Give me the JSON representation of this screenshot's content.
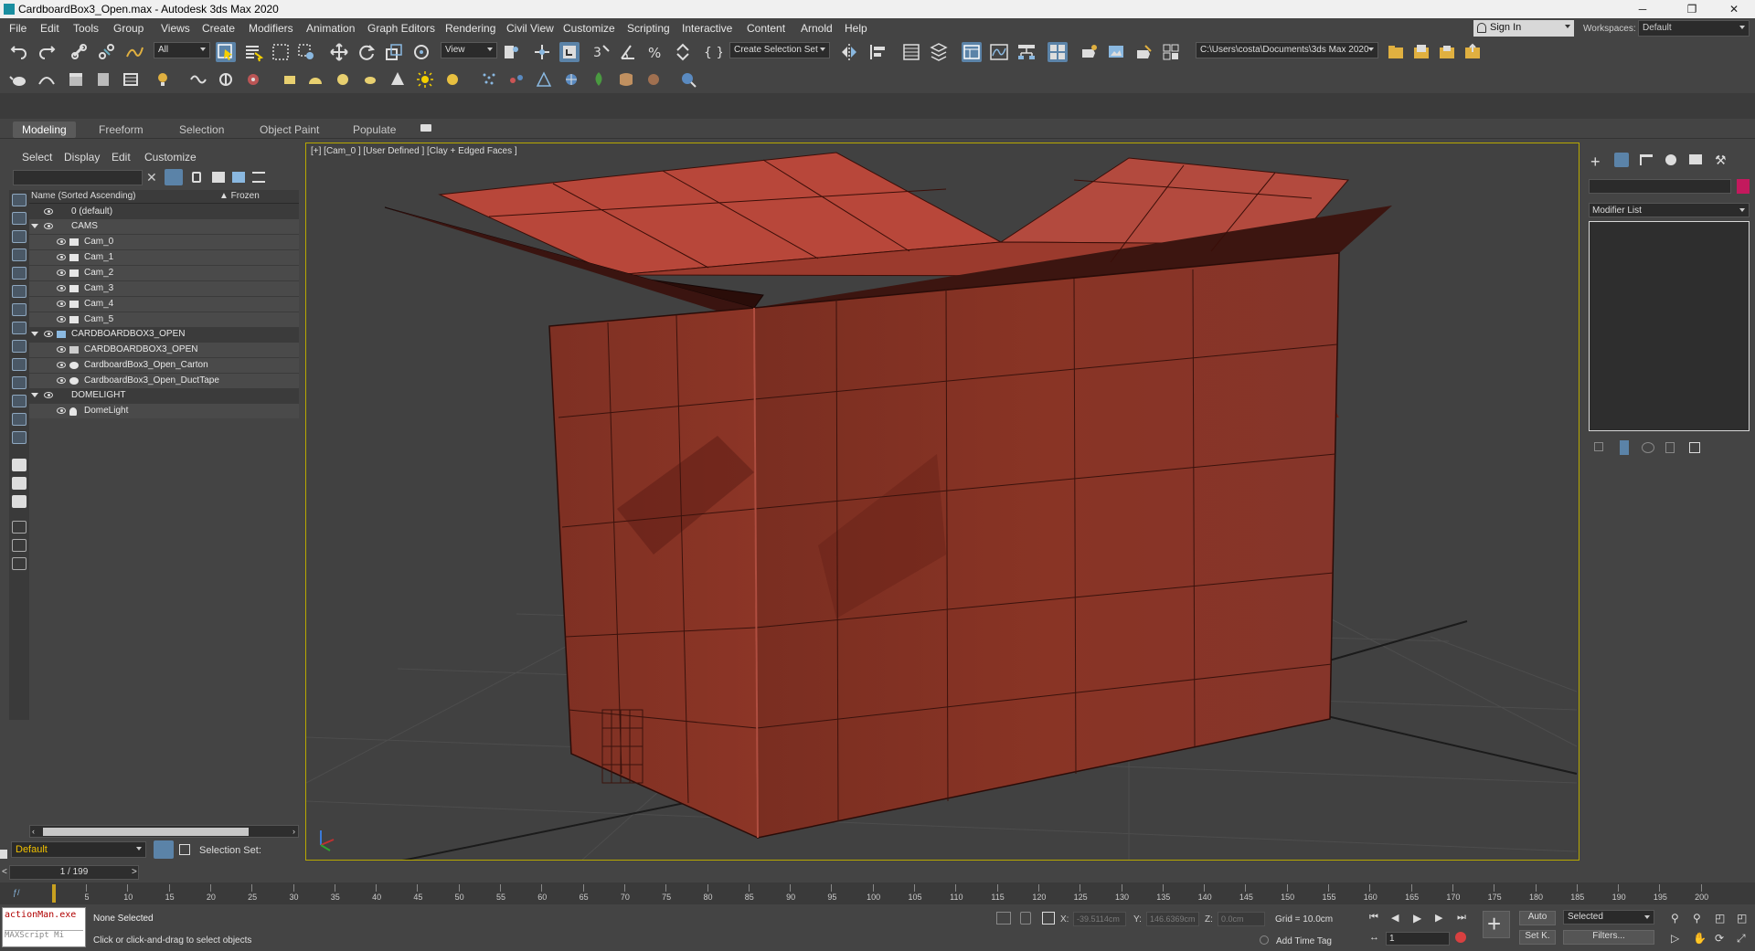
{
  "window": {
    "title": "CardboardBox3_Open.max - Autodesk 3ds Max 2020",
    "minimize": "─",
    "restore": "❐",
    "close": "✕"
  },
  "menu": [
    "File",
    "Edit",
    "Tools",
    "Group",
    "Views",
    "Create",
    "Modifiers",
    "Animation",
    "Graph Editors",
    "Rendering",
    "Civil View",
    "Customize",
    "Scripting",
    "Interactive",
    "Content",
    "Arnold",
    "Help"
  ],
  "signin": "Sign In",
  "workspaces": {
    "label": "Workspaces:",
    "value": "Default"
  },
  "toolbar": {
    "filter_dd": "All",
    "refcoord_dd": "View",
    "selection_set_dd": "Create Selection Set",
    "project_path": "C:\\Users\\costa\\Documents\\3ds Max 2020"
  },
  "ribbon_tabs": [
    "Modeling",
    "Freeform",
    "Selection",
    "Object Paint",
    "Populate"
  ],
  "scene_explorer": {
    "menu": [
      "Select",
      "Display",
      "Edit",
      "Customize"
    ],
    "col_name": "Name (Sorted Ascending)",
    "col_frozen": "▲ Frozen",
    "rows": [
      {
        "label": "0 (default)"
      },
      {
        "label": "CAMS"
      },
      {
        "label": "Cam_0"
      },
      {
        "label": "Cam_1"
      },
      {
        "label": "Cam_2"
      },
      {
        "label": "Cam_3"
      },
      {
        "label": "Cam_4"
      },
      {
        "label": "Cam_5"
      },
      {
        "label": "CARDBOARDBOX3_OPEN"
      },
      {
        "label": "CARDBOARDBOX3_OPEN"
      },
      {
        "label": "CardboardBox3_Open_Carton"
      },
      {
        "label": "CardboardBox3_Open_DuctTape"
      },
      {
        "label": "DOMELIGHT"
      },
      {
        "label": "DomeLight"
      }
    ],
    "layer": "Default",
    "selection_set_label": "Selection Set:"
  },
  "viewport": {
    "label": "[+] [Cam_0 ] [User Defined ] [Clay + Edged Faces ]"
  },
  "command_panel": {
    "modifier_list": "Modifier List"
  },
  "timeline": {
    "frame": "1 / 199",
    "ticks": [
      "5",
      "10",
      "15",
      "20",
      "25",
      "30",
      "35",
      "40",
      "45",
      "50",
      "55",
      "60",
      "65",
      "70",
      "75",
      "80",
      "85",
      "90",
      "95",
      "100",
      "105",
      "110",
      "115",
      "120",
      "125",
      "130",
      "135",
      "140",
      "145",
      "150",
      "155",
      "160",
      "165",
      "170",
      "175",
      "180",
      "185",
      "190",
      "195",
      "200"
    ]
  },
  "status": {
    "maxscript_line1": "actionMan.exe",
    "maxscript_line2": "MAXScript Mi",
    "selection": "None Selected",
    "prompt": "Click or click-and-drag to select objects",
    "x_label": "X:",
    "x_value": "-39.5114cm",
    "y_label": "Y:",
    "y_value": "146.6369cm",
    "z_label": "Z:",
    "z_value": "0.0cm",
    "grid": "Grid = 10.0cm",
    "add_time_tag": "Add Time Tag",
    "auto": "Auto",
    "set_key": "Set K.",
    "selected_dd": "Selected",
    "filters": "Filters...",
    "frame_field": "1"
  },
  "colors": {
    "box": "#8a3527",
    "box_flap": "#b8473a",
    "viewport_bg": "#414141",
    "viewport_border": "#b7a800",
    "accent": "#5b83a8"
  }
}
